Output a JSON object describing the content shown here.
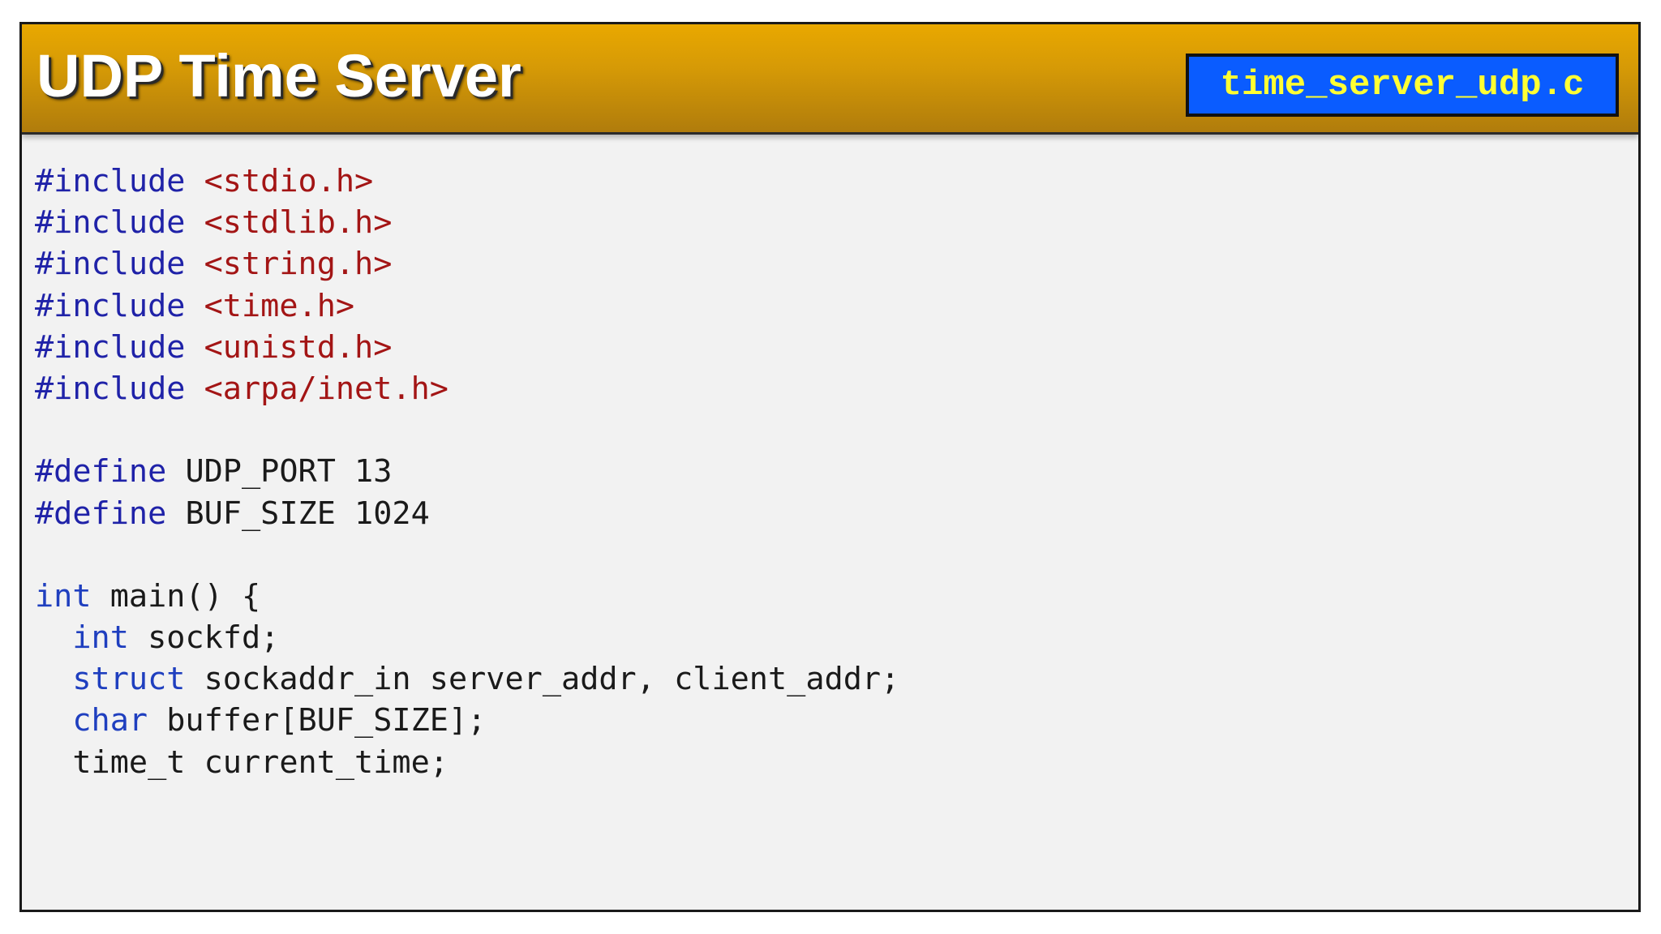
{
  "slide": {
    "title": "UDP Time Server",
    "filename": "time_server_udp.c"
  },
  "colors": {
    "header_top": "#e9a800",
    "header_bottom": "#b07c0c",
    "filename_bg": "#0a5cff",
    "filename_text": "#ffff33",
    "keyword": "#1f22a8",
    "string": "#a31515",
    "body_bg": "#f2f2f2"
  },
  "code": {
    "lines": [
      [
        {
          "t": "kw",
          "v": "#include"
        },
        {
          "t": "plain",
          "v": " "
        },
        {
          "t": "str",
          "v": "<stdio.h>"
        }
      ],
      [
        {
          "t": "kw",
          "v": "#include"
        },
        {
          "t": "plain",
          "v": " "
        },
        {
          "t": "str",
          "v": "<stdlib.h>"
        }
      ],
      [
        {
          "t": "kw",
          "v": "#include"
        },
        {
          "t": "plain",
          "v": " "
        },
        {
          "t": "str",
          "v": "<string.h>"
        }
      ],
      [
        {
          "t": "kw",
          "v": "#include"
        },
        {
          "t": "plain",
          "v": " "
        },
        {
          "t": "str",
          "v": "<time.h>"
        }
      ],
      [
        {
          "t": "kw",
          "v": "#include"
        },
        {
          "t": "plain",
          "v": " "
        },
        {
          "t": "str",
          "v": "<unistd.h>"
        }
      ],
      [
        {
          "t": "kw",
          "v": "#include"
        },
        {
          "t": "plain",
          "v": " "
        },
        {
          "t": "str",
          "v": "<arpa/inet.h>"
        }
      ],
      [],
      [
        {
          "t": "kw",
          "v": "#define"
        },
        {
          "t": "plain",
          "v": " UDP_PORT 13"
        }
      ],
      [
        {
          "t": "kw",
          "v": "#define"
        },
        {
          "t": "plain",
          "v": " BUF_SIZE 1024"
        }
      ],
      [],
      [
        {
          "t": "type",
          "v": "int"
        },
        {
          "t": "plain",
          "v": " main() {"
        }
      ],
      [
        {
          "t": "plain",
          "v": "  "
        },
        {
          "t": "type",
          "v": "int"
        },
        {
          "t": "plain",
          "v": " sockfd;"
        }
      ],
      [
        {
          "t": "plain",
          "v": "  "
        },
        {
          "t": "type",
          "v": "struct"
        },
        {
          "t": "plain",
          "v": " sockaddr_in server_addr, client_addr;"
        }
      ],
      [
        {
          "t": "plain",
          "v": "  "
        },
        {
          "t": "type",
          "v": "char"
        },
        {
          "t": "plain",
          "v": " buffer[BUF_SIZE];"
        }
      ],
      [
        {
          "t": "plain",
          "v": "  time_t current_time;"
        }
      ]
    ]
  }
}
